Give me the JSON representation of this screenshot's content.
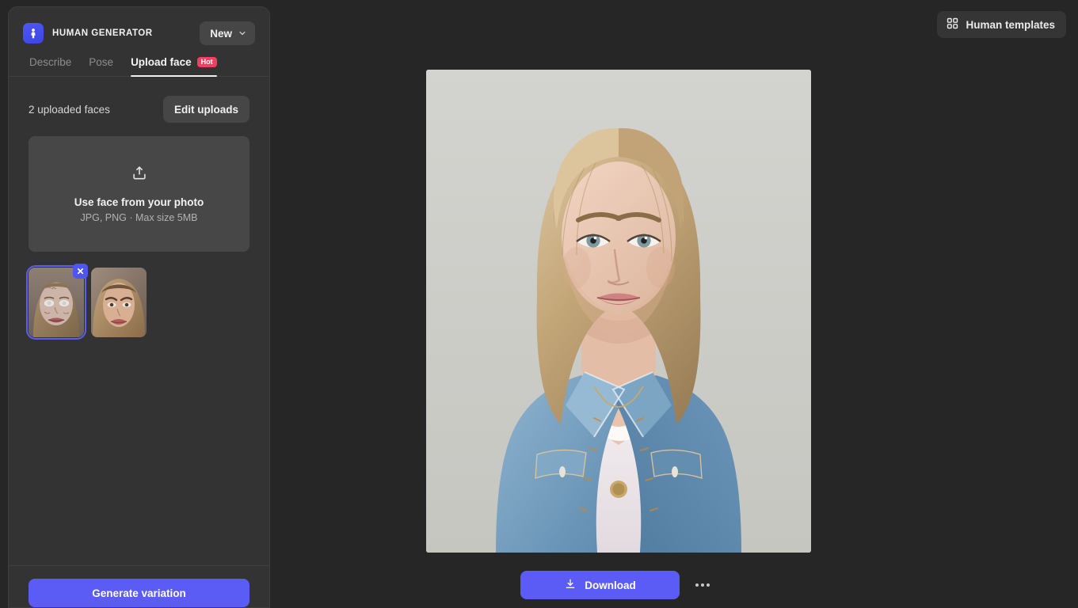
{
  "app": {
    "brand_name": "HUMAN GENERATOR",
    "logo_icon": "human-figure-icon",
    "background_color": "#262626",
    "panel_color": "#333333",
    "accent_color": "#5a5cf5",
    "hot_badge_color": "#f23e63"
  },
  "header": {
    "new_button": {
      "label": "New",
      "icon": "chevron-down-icon"
    },
    "templates_button": {
      "label": "Human templates",
      "icon": "grid-2x2-icon"
    }
  },
  "tabs": [
    {
      "id": "describe",
      "label": "Describe",
      "active": false,
      "badge": ""
    },
    {
      "id": "pose",
      "label": "Pose",
      "active": false,
      "badge": ""
    },
    {
      "id": "upload-face",
      "label": "Upload face",
      "active": true,
      "badge": "Hot"
    }
  ],
  "upload_panel": {
    "count_label": "2 uploaded faces",
    "edit_button_label": "Edit uploads",
    "dropzone": {
      "icon": "upload-icon",
      "title": "Use face from your photo",
      "subtitle": "JPG, PNG · Max size 5MB"
    },
    "thumbnails": [
      {
        "name": "uploaded-face-1",
        "selected": true,
        "remove_icon": "close-icon"
      },
      {
        "name": "uploaded-face-2",
        "selected": false,
        "remove_icon": ""
      }
    ]
  },
  "footer": {
    "generate_button_label": "Generate variation"
  },
  "canvas": {
    "result_image_alt": "Generated portrait of a blonde woman in a denim jacket over a white top with a gold pendant necklace",
    "download_button": {
      "label": "Download",
      "icon": "download-icon"
    },
    "more_button": {
      "label": "",
      "icon": "more-horizontal-icon"
    }
  }
}
